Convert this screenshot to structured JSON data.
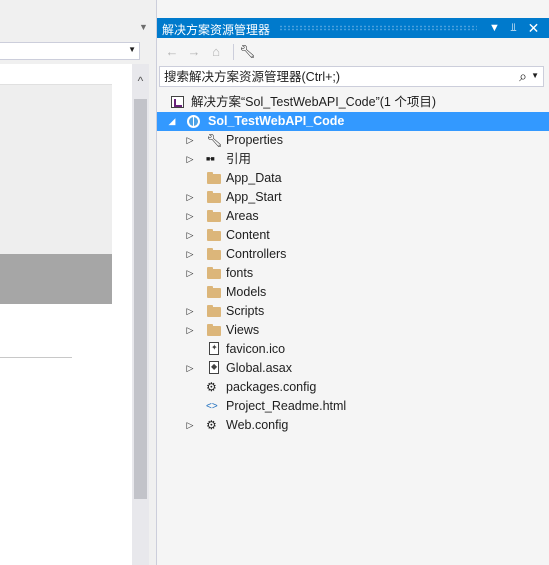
{
  "left_editor": {},
  "solution_explorer": {
    "title": "解决方案资源管理器",
    "title_buttons": [
      "chevron-down-icon",
      "pin-icon",
      "close-icon"
    ],
    "toolbar_icons": [
      "back-icon",
      "forward-icon",
      "home-icon",
      "wrench-icon"
    ],
    "search_placeholder": "搜索解决方案资源管理器(Ctrl+;)",
    "tree": [
      {
        "label": "解决方案“Sol_TestWebAPI_Code”(1 个项目)",
        "icon": "solution-icon",
        "level": 0,
        "expander": "",
        "selected": false
      },
      {
        "label": "Sol_TestWebAPI_Code",
        "icon": "web-project-icon",
        "level": 1,
        "expander": "expanded",
        "selected": true
      },
      {
        "label": "Properties",
        "icon": "wrench-icon",
        "level": 2,
        "expander": "collapsed",
        "selected": false
      },
      {
        "label": "引用",
        "icon": "references-icon",
        "level": 2,
        "expander": "collapsed",
        "selected": false
      },
      {
        "label": "App_Data",
        "icon": "folder-icon",
        "level": 2,
        "expander": "",
        "selected": false
      },
      {
        "label": "App_Start",
        "icon": "folder-icon",
        "level": 2,
        "expander": "collapsed",
        "selected": false
      },
      {
        "label": "Areas",
        "icon": "folder-icon",
        "level": 2,
        "expander": "collapsed",
        "selected": false
      },
      {
        "label": "Content",
        "icon": "folder-icon",
        "level": 2,
        "expander": "collapsed",
        "selected": false
      },
      {
        "label": "Controllers",
        "icon": "folder-icon",
        "level": 2,
        "expander": "collapsed",
        "selected": false
      },
      {
        "label": "fonts",
        "icon": "folder-icon",
        "level": 2,
        "expander": "collapsed",
        "selected": false
      },
      {
        "label": "Models",
        "icon": "folder-icon",
        "level": 2,
        "expander": "",
        "selected": false
      },
      {
        "label": "Scripts",
        "icon": "folder-icon",
        "level": 2,
        "expander": "collapsed",
        "selected": false
      },
      {
        "label": "Views",
        "icon": "folder-icon",
        "level": 2,
        "expander": "collapsed",
        "selected": false
      },
      {
        "label": "favicon.ico",
        "icon": "ico-file-icon",
        "level": 2,
        "expander": "",
        "selected": false
      },
      {
        "label": "Global.asax",
        "icon": "asax-file-icon",
        "level": 2,
        "expander": "collapsed",
        "selected": false
      },
      {
        "label": "packages.config",
        "icon": "config-file-icon",
        "level": 2,
        "expander": "",
        "selected": false
      },
      {
        "label": "Project_Readme.html",
        "icon": "html-file-icon",
        "level": 2,
        "expander": "",
        "selected": false
      },
      {
        "label": "Web.config",
        "icon": "config-file-icon",
        "level": 2,
        "expander": "collapsed",
        "selected": false
      }
    ]
  },
  "colors": {
    "accent": "#007acc",
    "selection": "#3399ff",
    "folder": "#dcb67a",
    "panel_bg": "#f5f5f5"
  }
}
